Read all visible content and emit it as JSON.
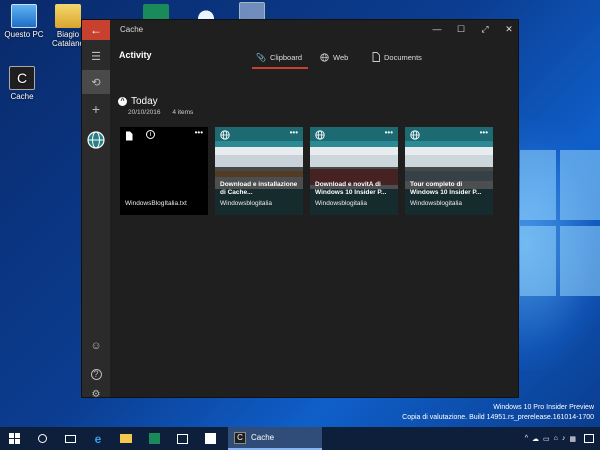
{
  "desktop": {
    "icons": [
      {
        "label": "Questo PC",
        "icon": "computer-icon"
      },
      {
        "label": "Biagio Catalano",
        "icon": "user-folder-icon"
      },
      {
        "label": "",
        "icon": "app-tile-icon"
      },
      {
        "label": "",
        "icon": "cloud-icon"
      },
      {
        "label": "",
        "icon": "recycle-bin-icon"
      },
      {
        "label": "Cache",
        "icon": "cache-app-icon"
      }
    ]
  },
  "window": {
    "title": "Cache",
    "controls": {
      "minimize": "—",
      "restore": "☐",
      "fullscreen": "⤢",
      "close": "✕"
    },
    "back_icon": "←"
  },
  "sidebar": {
    "items": [
      {
        "name": "menu",
        "glyph": "☰"
      },
      {
        "name": "history",
        "glyph": "⟲"
      },
      {
        "name": "add",
        "glyph": "+"
      },
      {
        "name": "globe",
        "glyph": ""
      },
      {
        "name": "feedback",
        "glyph": "☺"
      },
      {
        "name": "help",
        "glyph": "?"
      },
      {
        "name": "settings",
        "glyph": "⚙"
      }
    ]
  },
  "header": {
    "title": "Activity",
    "tabs": [
      {
        "label": "Clipboard",
        "active": true
      },
      {
        "label": "Web",
        "active": false
      },
      {
        "label": "Documents",
        "active": false
      }
    ]
  },
  "section": {
    "title": "Today",
    "date": "20/10/2016",
    "count": "4 items"
  },
  "cards": [
    {
      "type": "file",
      "title": "",
      "source": "WindowsBlogItalia.txt"
    },
    {
      "type": "web",
      "title": "Download e installazione di Cache...",
      "source": "Windowsblogitalia"
    },
    {
      "type": "web",
      "title": "Download e novitA  di Windows 10 Insider P...",
      "source": "Windowsblogitalia"
    },
    {
      "type": "web",
      "title": "Tour completo di Windows 10 Insider P...",
      "source": "Windowsblogitalia"
    }
  ],
  "watermark": {
    "line1": "Windows 10 Pro Insider Preview",
    "line2": "Copia di valutazione. Build 14951.rs_prerelease.161014-1700"
  },
  "taskbar": {
    "active_app": "Cache",
    "active_glyph": "C"
  },
  "colors": {
    "accent": "#c8402e",
    "window_bg": "#1f1f1f",
    "sidebar_bg": "#2b2b2b",
    "card_web": "#1e6a72",
    "taskbar": "#0d1f3b"
  }
}
